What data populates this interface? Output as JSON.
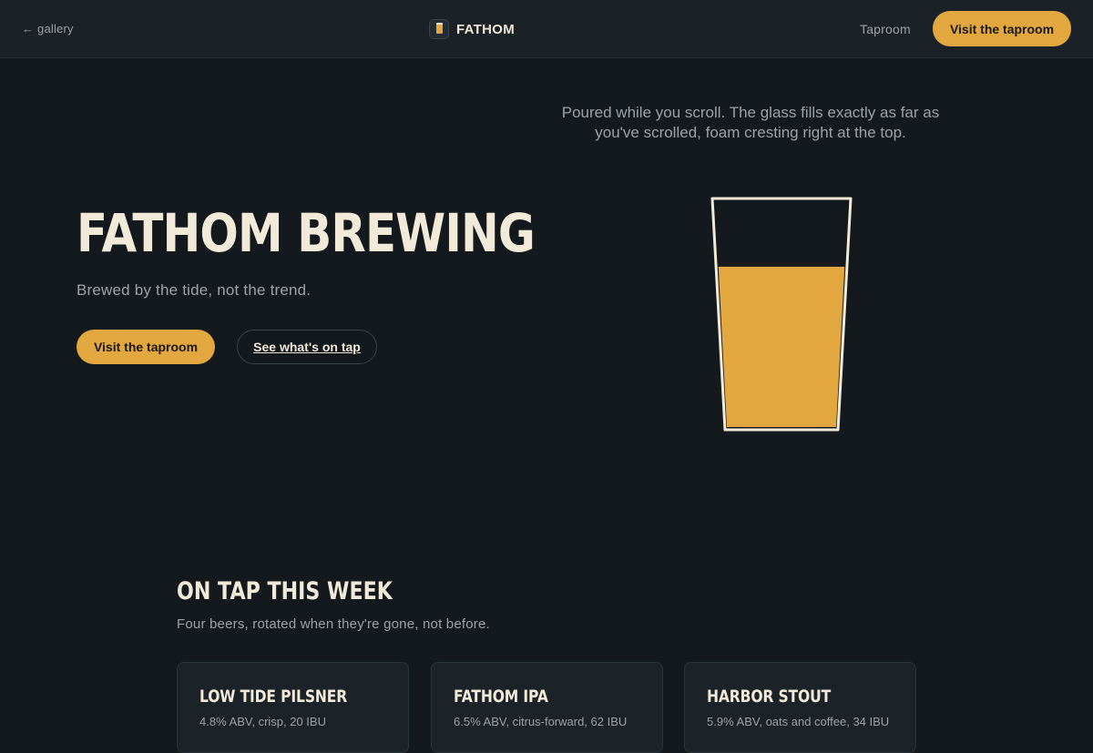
{
  "header": {
    "back_label": "← gallery",
    "brand_name": "FATHOM",
    "nav_link": "Taproom",
    "cta_label": "Visit the taproom"
  },
  "intro": {
    "copy": "Poured while you scroll. The glass fills exactly as far as you've scrolled, foam cresting right at the top."
  },
  "hero": {
    "title": "FATHOM BREWING",
    "tagline": "Brewed by the tide, not the trend.",
    "primary_cta": "Visit the taproom",
    "secondary_cta": "See what's on tap"
  },
  "glass": {
    "fill_fraction": 0.71
  },
  "on_tap": {
    "title": "ON TAP THIS WEEK",
    "subtitle": "Four beers, rotated when they're gone, not before.",
    "beers": [
      {
        "name": "LOW TIDE PILSNER",
        "desc": "4.8% ABV, crisp, 20 IBU"
      },
      {
        "name": "FATHOM IPA",
        "desc": "6.5% ABV, citrus-forward, 62 IBU"
      },
      {
        "name": "HARBOR STOUT",
        "desc": "5.9% ABV, oats and coffee, 34 IBU"
      }
    ]
  },
  "colors": {
    "background": "#13191c",
    "header_bg": "#1a2127",
    "accent": "#e2a83f",
    "text_primary": "#f1ead9",
    "text_muted": "#9aa3a8"
  }
}
